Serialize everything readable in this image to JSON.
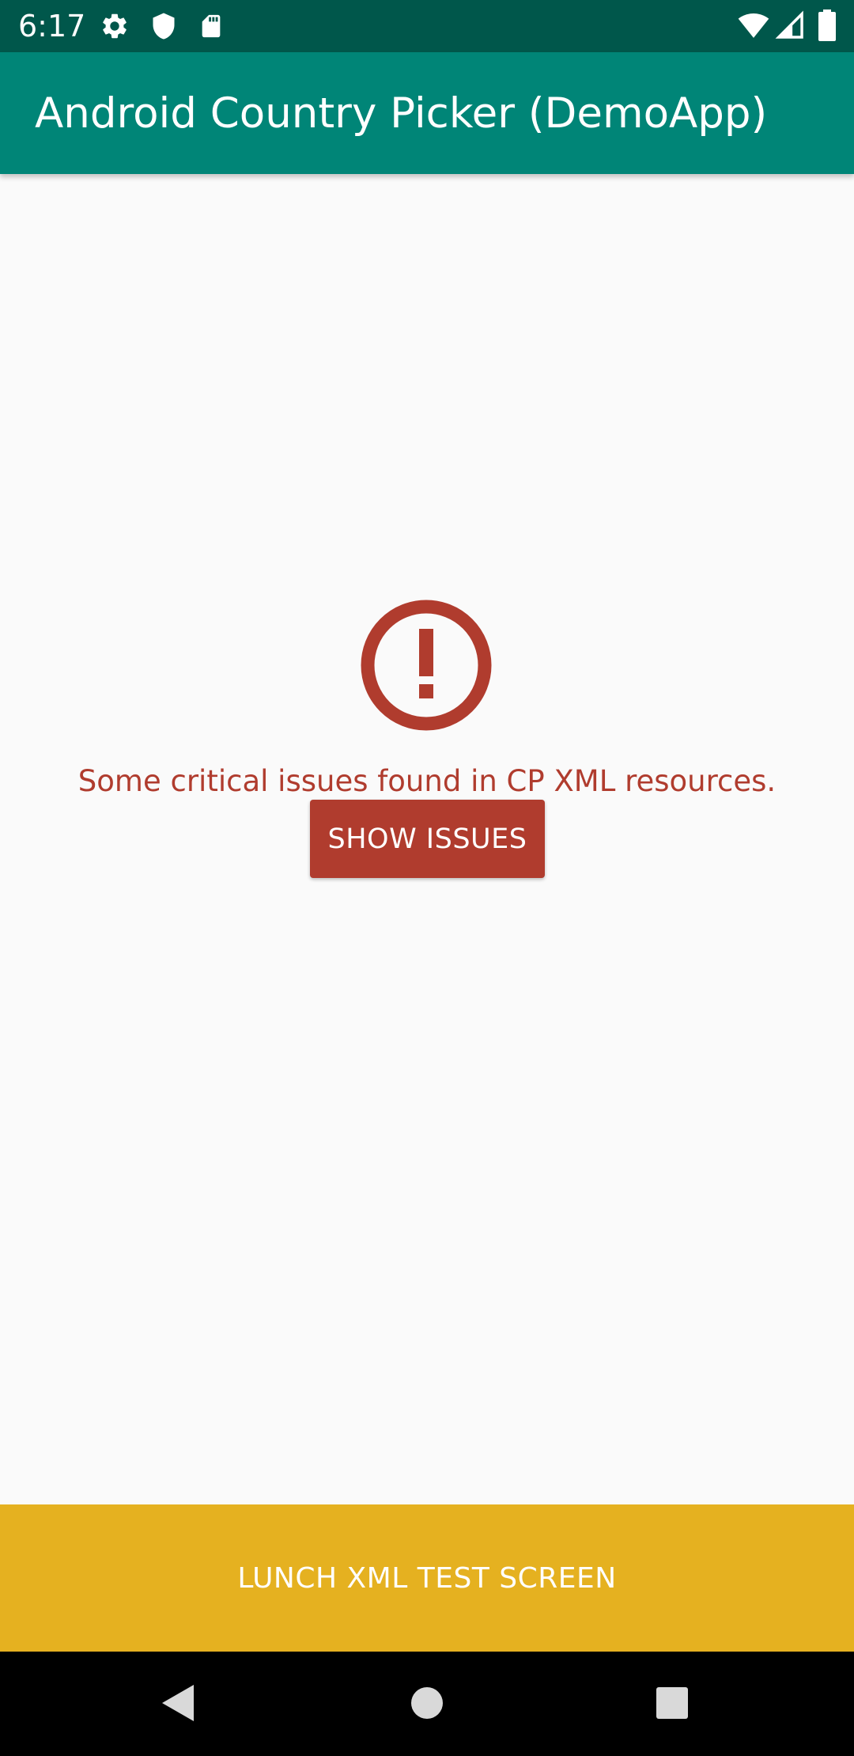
{
  "status_bar": {
    "time": "6:17",
    "icons": [
      "settings-gear-icon",
      "shield-icon",
      "sd-card-icon",
      "wifi-icon",
      "cell-signal-icon",
      "battery-icon"
    ]
  },
  "app_bar": {
    "title": "Android Country Picker (DemoApp)"
  },
  "main": {
    "error_icon": "error-circle-exclamation-icon",
    "error_message": "Some critical issues found in CP XML resources.",
    "show_issues_label": "SHOW ISSUES"
  },
  "bottom_action": {
    "label": "LUNCH XML TEST SCREEN"
  },
  "nav_bar": {
    "icons": [
      "back-icon",
      "home-icon",
      "recents-icon"
    ]
  },
  "colors": {
    "status_bar": "#00574b",
    "app_bar": "#008577",
    "error_red": "#b03c2e",
    "bottom_button": "#e5b120",
    "background": "#fafafa",
    "nav_bar": "#000000"
  }
}
